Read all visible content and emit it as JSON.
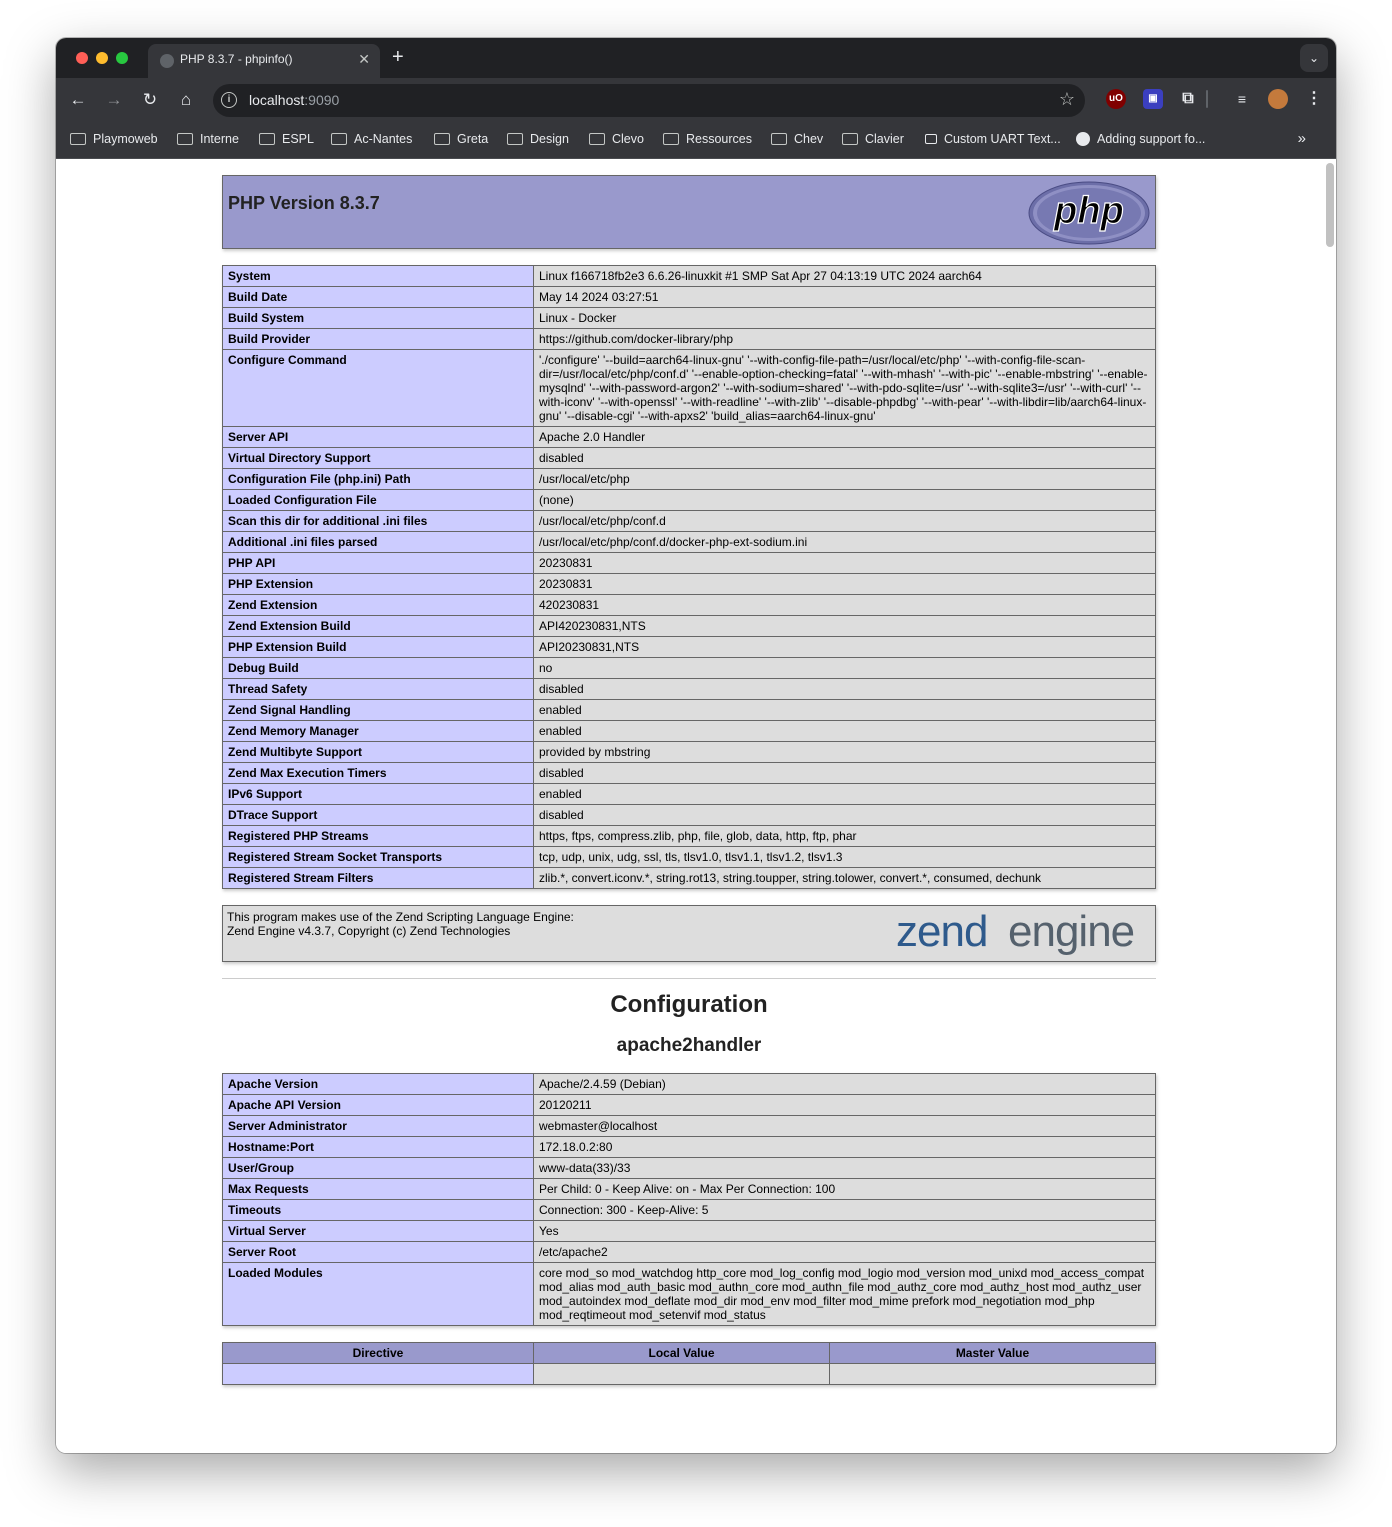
{
  "browser": {
    "tab_title": "PHP 8.3.7 - phpinfo()",
    "url_host": "localhost",
    "url_port": ":9090",
    "bookmarks": [
      "Playmoweb",
      "Interne",
      "ESPL",
      "Ac-Nantes",
      "Greta",
      "Design",
      "Clevo",
      "Ressources",
      "Chev",
      "Clavier",
      "Custom UART Text...",
      "Adding support fo..."
    ]
  },
  "page": {
    "title": "PHP Version 8.3.7",
    "logo_text": "php",
    "system_rows": [
      {
        "k": "System",
        "v": "Linux f166718fb2e3 6.6.26-linuxkit #1 SMP Sat Apr 27 04:13:19 UTC 2024 aarch64"
      },
      {
        "k": "Build Date",
        "v": "May 14 2024 03:27:51"
      },
      {
        "k": "Build System",
        "v": "Linux - Docker"
      },
      {
        "k": "Build Provider",
        "v": "https://github.com/docker-library/php"
      },
      {
        "k": "Configure Command",
        "v": "'./configure' '--build=aarch64-linux-gnu' '--with-config-file-path=/usr/local/etc/php' '--with-config-file-scan-dir=/usr/local/etc/php/conf.d' '--enable-option-checking=fatal' '--with-mhash' '--with-pic' '--enable-mbstring' '--enable-mysqlnd' '--with-password-argon2' '--with-sodium=shared' '--with-pdo-sqlite=/usr' '--with-sqlite3=/usr' '--with-curl' '--with-iconv' '--with-openssl' '--with-readline' '--with-zlib' '--disable-phpdbg' '--with-pear' '--with-libdir=lib/aarch64-linux-gnu' '--disable-cgi' '--with-apxs2' 'build_alias=aarch64-linux-gnu'"
      },
      {
        "k": "Server API",
        "v": "Apache 2.0 Handler"
      },
      {
        "k": "Virtual Directory Support",
        "v": "disabled"
      },
      {
        "k": "Configuration File (php.ini) Path",
        "v": "/usr/local/etc/php"
      },
      {
        "k": "Loaded Configuration File",
        "v": "(none)"
      },
      {
        "k": "Scan this dir for additional .ini files",
        "v": "/usr/local/etc/php/conf.d"
      },
      {
        "k": "Additional .ini files parsed",
        "v": "/usr/local/etc/php/conf.d/docker-php-ext-sodium.ini"
      },
      {
        "k": "PHP API",
        "v": "20230831"
      },
      {
        "k": "PHP Extension",
        "v": "20230831"
      },
      {
        "k": "Zend Extension",
        "v": "420230831"
      },
      {
        "k": "Zend Extension Build",
        "v": "API420230831,NTS"
      },
      {
        "k": "PHP Extension Build",
        "v": "API20230831,NTS"
      },
      {
        "k": "Debug Build",
        "v": "no"
      },
      {
        "k": "Thread Safety",
        "v": "disabled"
      },
      {
        "k": "Zend Signal Handling",
        "v": "enabled"
      },
      {
        "k": "Zend Memory Manager",
        "v": "enabled"
      },
      {
        "k": "Zend Multibyte Support",
        "v": "provided by mbstring"
      },
      {
        "k": "Zend Max Execution Timers",
        "v": "disabled"
      },
      {
        "k": "IPv6 Support",
        "v": "enabled"
      },
      {
        "k": "DTrace Support",
        "v": "disabled"
      },
      {
        "k": "Registered PHP Streams",
        "v": "https, ftps, compress.zlib, php, file, glob, data, http, ftp, phar"
      },
      {
        "k": "Registered Stream Socket Transports",
        "v": "tcp, udp, unix, udg, ssl, tls, tlsv1.0, tlsv1.1, tlsv1.2, tlsv1.3"
      },
      {
        "k": "Registered Stream Filters",
        "v": "zlib.*, convert.iconv.*, string.rot13, string.toupper, string.tolower, convert.*, consumed, dechunk"
      }
    ],
    "zend_line1": "This program makes use of the Zend Scripting Language Engine:",
    "zend_line2": "Zend Engine v4.3.7, Copyright (c) Zend Technologies",
    "zend_logo": {
      "a": "zend",
      "b": "engine"
    },
    "configuration_heading": "Configuration",
    "module_heading": "apache2handler",
    "apache_rows": [
      {
        "k": "Apache Version",
        "v": "Apache/2.4.59 (Debian)"
      },
      {
        "k": "Apache API Version",
        "v": "20120211"
      },
      {
        "k": "Server Administrator",
        "v": "webmaster@localhost"
      },
      {
        "k": "Hostname:Port",
        "v": "172.18.0.2:80"
      },
      {
        "k": "User/Group",
        "v": "www-data(33)/33"
      },
      {
        "k": "Max Requests",
        "v": "Per Child: 0 - Keep Alive: on - Max Per Connection: 100"
      },
      {
        "k": "Timeouts",
        "v": "Connection: 300 - Keep-Alive: 5"
      },
      {
        "k": "Virtual Server",
        "v": "Yes"
      },
      {
        "k": "Server Root",
        "v": "/etc/apache2"
      },
      {
        "k": "Loaded Modules",
        "v": "core mod_so mod_watchdog http_core mod_log_config mod_logio mod_version mod_unixd mod_access_compat mod_alias mod_auth_basic mod_authn_core mod_authn_file mod_authz_core mod_authz_host mod_authz_user mod_autoindex mod_deflate mod_dir mod_env mod_filter mod_mime prefork mod_negotiation mod_php mod_reqtimeout mod_setenvif mod_status"
      }
    ],
    "directive_headers": [
      "Directive",
      "Local Value",
      "Master Value"
    ]
  },
  "colors": {
    "php_header": "#9999cc",
    "row_key": "#ccccff",
    "row_value": "#dddddd"
  }
}
